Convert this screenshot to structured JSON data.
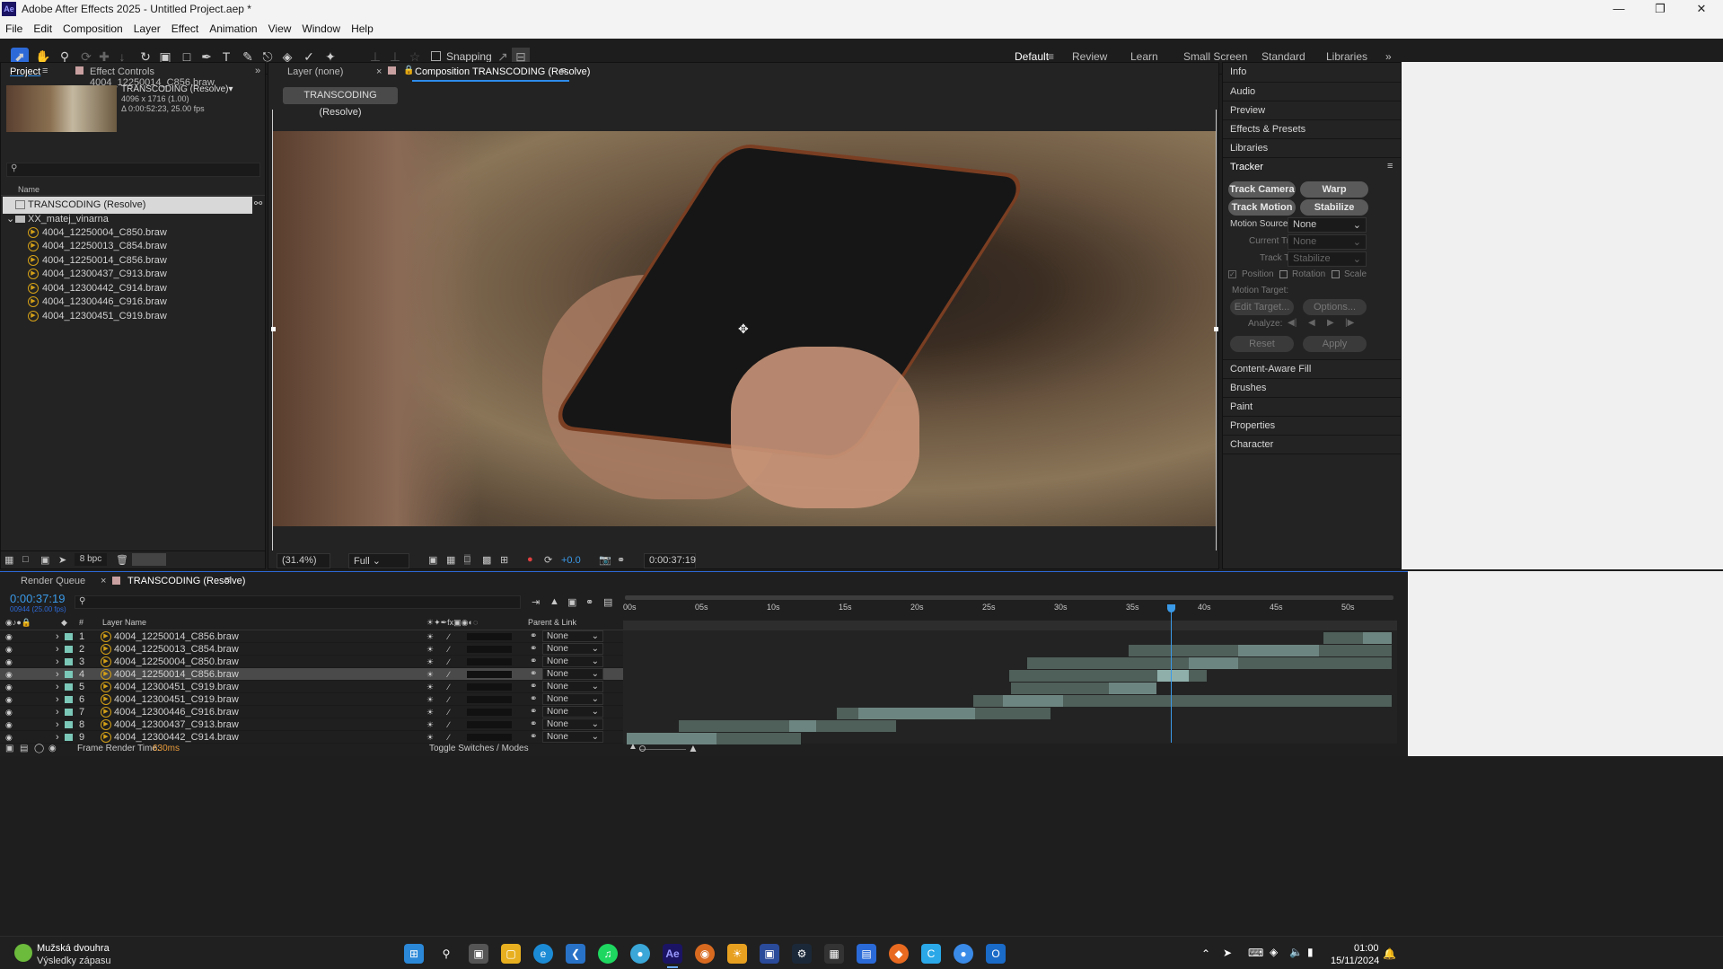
{
  "window": {
    "title": "Adobe After Effects 2025 - Untitled Project.aep *",
    "app_icon": "Ae"
  },
  "menu": [
    "File",
    "Edit",
    "Composition",
    "Layer",
    "Effect",
    "Animation",
    "View",
    "Window",
    "Help"
  ],
  "toolbar": {
    "snapping_label": "Snapping",
    "workspaces": [
      "Default",
      "Review",
      "Learn",
      "Small Screen",
      "Standard",
      "Libraries"
    ],
    "active_workspace": "Default"
  },
  "project": {
    "tab": "Project",
    "effect_controls_tab": "Effect Controls 4004_12250014_C856.braw",
    "comp_name": "TRANSCODING (Resolve)▾",
    "comp_res": "4096 x 1716 (1.00)",
    "comp_dur": "Δ 0:00:52:23, 25.00 fps",
    "search_placeholder": "",
    "name_header": "Name",
    "items": [
      "TRANSCODING (Resolve)",
      "XX_matej_vinarna",
      "4004_12250004_C850.braw",
      "4004_12250013_C854.braw",
      "4004_12250014_C856.braw",
      "4004_12300437_C913.braw",
      "4004_12300442_C914.braw",
      "4004_12300446_C916.braw",
      "4004_12300451_C919.braw"
    ],
    "bpc": "8 bpc"
  },
  "viewer": {
    "layer_tab": "Layer (none)",
    "comp_tab": "Composition TRANSCODING (Resolve)",
    "comp_chip": "TRANSCODING (Resolve)",
    "zoom": "(31.4%)",
    "quality": "Full",
    "exposure": "+0.0",
    "timecode": "0:00:37:19"
  },
  "right_panel": {
    "items_top": [
      "Info",
      "Audio",
      "Preview",
      "Effects & Presets",
      "Libraries"
    ],
    "tracker_title": "Tracker",
    "track_camera": "Track Camera",
    "warp_stabilizer": "Warp Stabilizer",
    "track_motion": "Track Motion",
    "stabilize_motion": "Stabilize Motion",
    "motion_source_label": "Motion Source:",
    "motion_source": "None",
    "current_track_label": "Current Track:",
    "current_track": "None",
    "track_type_label": "Track Type:",
    "track_type": "Stabilize",
    "position": "Position",
    "rotation": "Rotation",
    "scale": "Scale",
    "motion_target": "Motion Target:",
    "edit_target": "Edit Target...",
    "options": "Options...",
    "analyze": "Analyze:",
    "reset": "Reset",
    "apply": "Apply",
    "items_bottom": [
      "Content-Aware Fill",
      "Brushes",
      "Paint",
      "Properties",
      "Character"
    ]
  },
  "timeline": {
    "render_queue_tab": "Render Queue",
    "comp_tab": "TRANSCODING (Resolve)",
    "timecode": "0:00:37:19",
    "sub_timecode": "00944 (25.00 fps)",
    "col_num": "#",
    "col_layer": "Layer Name",
    "col_parent": "Parent & Link",
    "ruler": [
      "00s",
      "05s",
      "10s",
      "15s",
      "20s",
      "25s",
      "30s",
      "35s",
      "40s",
      "45s",
      "50s"
    ],
    "render_time_label": "Frame Render Time:",
    "render_time": "630ms",
    "toggle_label": "Toggle Switches / Modes",
    "layers": [
      {
        "n": "1",
        "name": "4004_12250014_C856.braw",
        "parent": "None"
      },
      {
        "n": "2",
        "name": "4004_12250013_C854.braw",
        "parent": "None"
      },
      {
        "n": "3",
        "name": "4004_12250004_C850.braw",
        "parent": "None"
      },
      {
        "n": "4",
        "name": "4004_12250014_C856.braw",
        "parent": "None"
      },
      {
        "n": "5",
        "name": "4004_12300451_C919.braw",
        "parent": "None"
      },
      {
        "n": "6",
        "name": "4004_12300451_C919.braw",
        "parent": "None"
      },
      {
        "n": "7",
        "name": "4004_12300446_C916.braw",
        "parent": "None"
      },
      {
        "n": "8",
        "name": "4004_12300437_C913.braw",
        "parent": "None"
      },
      {
        "n": "9",
        "name": "4004_12300442_C914.braw",
        "parent": "None"
      }
    ],
    "selected_layer": 4
  },
  "taskbar": {
    "widget_title": "Mužská dvouhra",
    "widget_sub": "Výsledky zápasu",
    "time": "01:00",
    "date": "15/11/2024"
  }
}
